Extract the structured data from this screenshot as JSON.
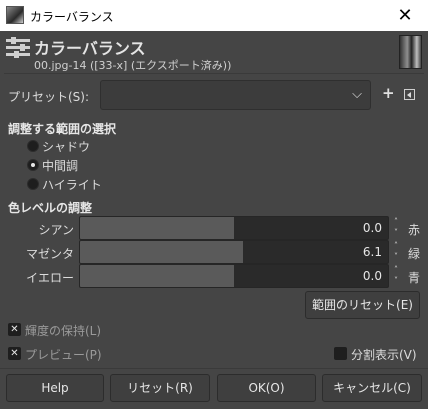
{
  "window": {
    "title": "カラーバランス",
    "close_glyph": "✕"
  },
  "header": {
    "title": "カラーバランス",
    "subtitle": "00.jpg-14 ([33-x] (エクスポート済み))"
  },
  "preset": {
    "label": "プリセット(S):",
    "value": "",
    "add_glyph": "+"
  },
  "range_section": {
    "title": "調整する範囲の選択",
    "options": [
      {
        "label": "シャドウ",
        "selected": false
      },
      {
        "label": "中間調",
        "selected": true
      },
      {
        "label": "ハイライト",
        "selected": false
      }
    ]
  },
  "color_section": {
    "title": "色レベルの調整",
    "sliders": [
      {
        "left": "シアン",
        "right": "赤",
        "value": "0.0",
        "level": 0.0
      },
      {
        "left": "マゼンタ",
        "right": "緑",
        "value": "6.1",
        "level": 6.1
      },
      {
        "left": "イエロー",
        "right": "青",
        "value": "0.0",
        "level": 0.0
      }
    ],
    "reset_range_label": "範囲のリセット(E)"
  },
  "preserve_luminosity": {
    "label": "輝度の保持(L)",
    "checked": true
  },
  "preview": {
    "label": "プレビュー(P)",
    "checked": true
  },
  "split_view": {
    "label": "分割表示(V)",
    "checked": false
  },
  "buttons": {
    "help": "Help",
    "reset": "リセット(R)",
    "ok": "OK(O)",
    "cancel": "キャンセル(C)"
  }
}
